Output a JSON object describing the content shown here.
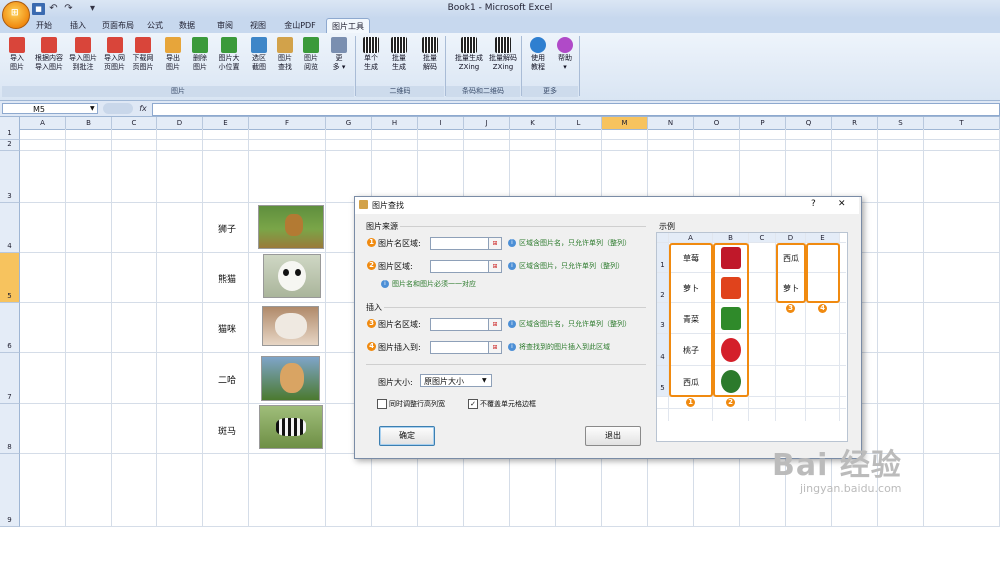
{
  "window": {
    "title": "Book1 - Microsoft Excel"
  },
  "qat": {
    "save_icon": "save-icon",
    "undo": "↶",
    "redo": "↷",
    "more": "▾"
  },
  "tabs": [
    "开始",
    "插入",
    "页面布局",
    "公式",
    "数据",
    "审阅",
    "视图",
    "金山PDF",
    "图片工具"
  ],
  "ribbon": {
    "buttons": [
      {
        "label": "导入\n图片",
        "color": "#d9453a"
      },
      {
        "label": "根据内容\n导入图片",
        "color": "#d9453a"
      },
      {
        "label": "导入图片\n到批注",
        "color": "#d9453a"
      },
      {
        "label": "导入网\n页图片",
        "color": "#d9453a"
      },
      {
        "label": "下载网\n页图片",
        "color": "#d9453a"
      },
      {
        "label": "导出\n图片",
        "color": "#e7a53a"
      },
      {
        "label": "删除\n图片",
        "color": "#3b9a3b"
      },
      {
        "label": "图片大\n小位置",
        "color": "#3b9a3b"
      },
      {
        "label": "选区\n截图",
        "color": "#3e86c8"
      },
      {
        "label": "图片\n查找",
        "color": "#d2a24a"
      },
      {
        "label": "图片\n阅览",
        "color": "#3b9a3b"
      },
      {
        "label": "更\n多 ▾",
        "color": "#7a8fb0"
      },
      {
        "label": "单个\n生成",
        "color": "#222222"
      },
      {
        "label": "批量\n生成",
        "color": "#222222"
      },
      {
        "label": "批量\n解码",
        "color": "#222222"
      },
      {
        "label": "批量生成\nZXing",
        "color": "#222222"
      },
      {
        "label": "批量解码\nZXing",
        "color": "#222222"
      },
      {
        "label": "使用\n教程",
        "color": "#2f7fd0"
      },
      {
        "label": "帮助\n▾",
        "color": "#b04ac8"
      }
    ],
    "groups": [
      "图片",
      "二维码",
      "条码和二维码",
      "更多"
    ]
  },
  "formula_bar": {
    "name_box": "M5",
    "fx": "fx",
    "value": ""
  },
  "grid": {
    "columns": [
      "A",
      "B",
      "C",
      "D",
      "E",
      "F",
      "G",
      "H",
      "I",
      "J",
      "K",
      "L",
      "M",
      "N",
      "O",
      "P",
      "Q",
      "R",
      "S",
      "T"
    ],
    "selected_column": "M",
    "rows": [
      "1",
      "2",
      "3",
      "4",
      "5",
      "6",
      "7",
      "8",
      "9"
    ],
    "selected_row": "5",
    "animals": [
      "狮子",
      "熊猫",
      "猫咪",
      "二哈",
      "斑马"
    ]
  },
  "dialog": {
    "title": "图片查找",
    "help": "?",
    "close": "✕",
    "section_source": "图片来源",
    "section_insert": "插入",
    "fields": [
      {
        "num": "1",
        "label": "图片名区域:",
        "hint": "区域含图片名，只允许单列（整列）"
      },
      {
        "num": "2",
        "label": "图片区域:",
        "hint": "区域含图片，只允许单列（整列）"
      },
      {
        "num": "3",
        "label": "图片名区域:",
        "hint": "区域含图片名，只允许单列（整列）"
      },
      {
        "num": "4",
        "label": "图片插入到:",
        "hint": "将查找到的图片插入到此区域"
      }
    ],
    "note": "图片名和图片必须一一对应",
    "size_label": "图片大小:",
    "size_value": "原图片大小",
    "check_adjust": "同时调整行高列宽",
    "check_border": "不覆盖单元格边框",
    "check_border_checked": "✓",
    "ok": "确定",
    "cancel": "退出",
    "example_title": "示例",
    "example": {
      "cols": [
        "A",
        "B",
        "C",
        "D",
        "E"
      ],
      "rows": [
        "1",
        "2",
        "3",
        "4",
        "5"
      ],
      "names": [
        "草莓",
        "萝卜",
        "青菜",
        "桃子",
        "西瓜"
      ],
      "targets": [
        "西瓜",
        "萝卜"
      ],
      "markers": [
        "1",
        "2",
        "3",
        "4"
      ]
    }
  },
  "watermark": {
    "brand": "Bai  经验",
    "url": "jingyan.baidu.com"
  }
}
